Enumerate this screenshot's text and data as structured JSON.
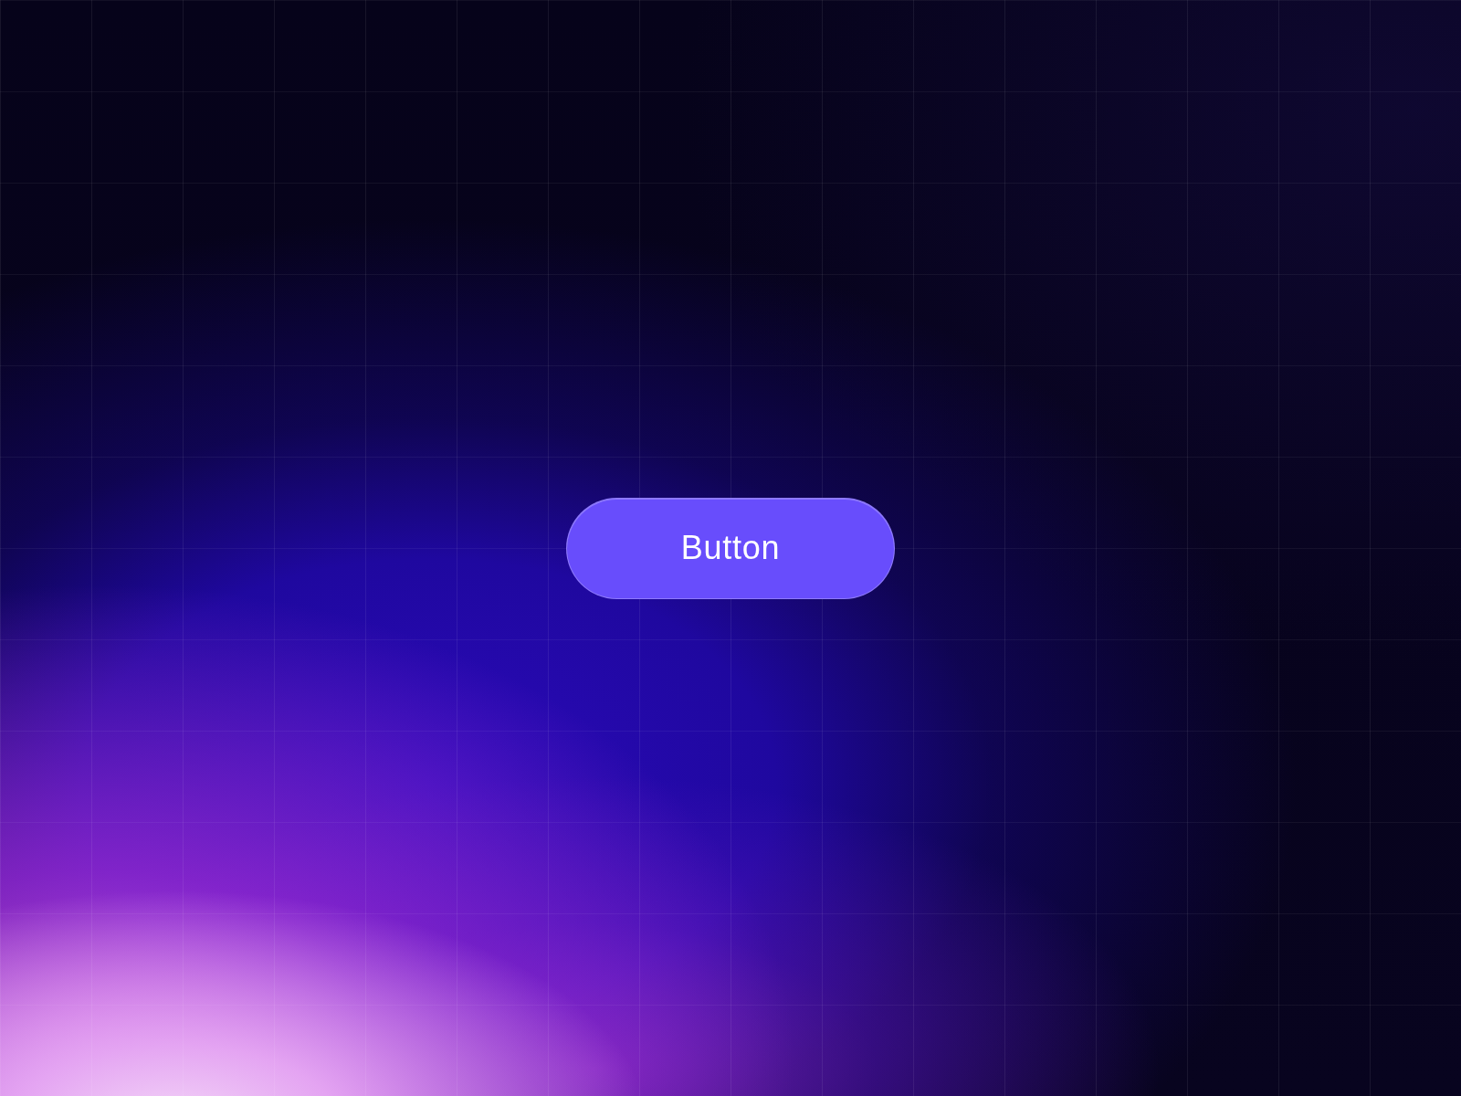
{
  "button": {
    "label": "Button"
  }
}
